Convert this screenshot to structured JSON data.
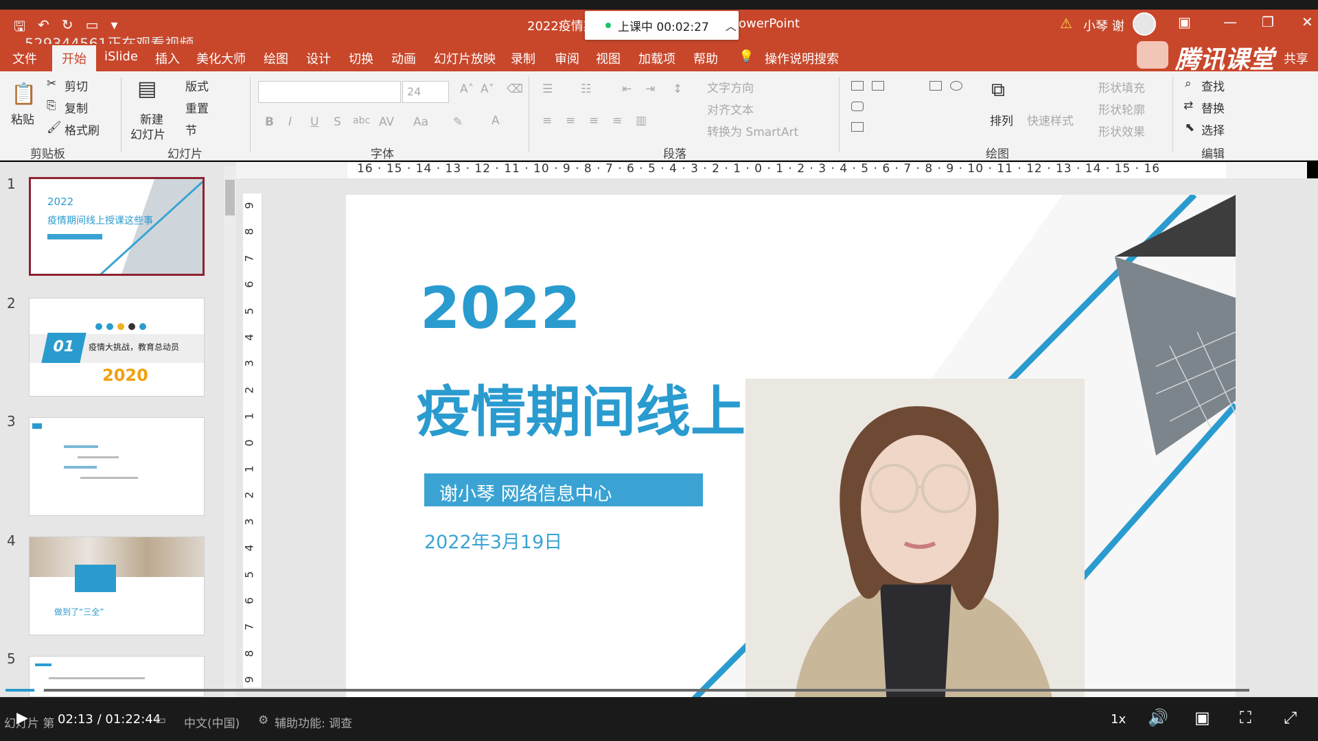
{
  "window": {
    "title_left": "2022疫情期",
    "title_right": "owerPoint",
    "viewer_notice": "529344561正在观看视频",
    "user_name": "小琴 谢"
  },
  "live_status": {
    "label": "上课中 00:02:27"
  },
  "brand": {
    "name": "腾讯课堂",
    "share": "共享"
  },
  "tabs": [
    "文件",
    "开始",
    "iSlide",
    "插入",
    "美化大师",
    "绘图",
    "设计",
    "切换",
    "动画",
    "幻灯片放映",
    "录制",
    "审阅",
    "视图",
    "加载项",
    "帮助",
    "操作说明搜索"
  ],
  "ribbon": {
    "clipboard": {
      "paste": "粘贴",
      "cut": "剪切",
      "copy": "复制",
      "format_painter": "格式刷",
      "label": "剪贴板"
    },
    "slides": {
      "new_slide_1": "新建",
      "new_slide_2": "幻灯片",
      "layout": "版式",
      "reset": "重置",
      "section": "节",
      "label": "幻灯片"
    },
    "font": {
      "size": "24",
      "label": "字体"
    },
    "paragraph": {
      "text_direction": "文字方向",
      "align_text": "对齐文本",
      "convert_smartart": "转换为 SmartArt",
      "label": "段落"
    },
    "drawing": {
      "arrange": "排列",
      "quick_styles": "快速样式",
      "shape_fill": "形状填充",
      "shape_outline": "形状轮廓",
      "shape_effects": "形状效果",
      "label": "绘图"
    },
    "editing": {
      "find": "查找",
      "replace": "替换",
      "select": "选择",
      "label": "编辑"
    }
  },
  "ruler": {
    "horizontal": "16 · 15 · 14 · 13 · 12 · 11 · 10 · 9 · 8 · 7 · 6 · 5 · 4 · 3 · 2 · 1 · 0 · 1 · 2 · 3 · 4 · 5 · 6 · 7 · 8 · 9 · 10 · 11 · 12 · 13 · 14 · 15 · 16",
    "vertical": [
      "9",
      "8",
      "7",
      "6",
      "5",
      "4",
      "3",
      "2",
      "1",
      "0",
      "1",
      "2",
      "3",
      "4",
      "5",
      "6",
      "7",
      "8",
      "9"
    ]
  },
  "thumbnails": [
    {
      "num": "1",
      "line1": "2022",
      "line2": "疫情期间线上授课这些事"
    },
    {
      "num": "2",
      "badge": "01",
      "caption": "疫情大挑战，教育总动员",
      "year": "2020"
    },
    {
      "num": "3"
    },
    {
      "num": "4",
      "caption": "做到了“三全”"
    },
    {
      "num": "5"
    }
  ],
  "slide": {
    "year": "2022",
    "title": "疫情期间线上授课这些事",
    "presenter": "谢小琴  网络信息中心",
    "date": "2022年3月19日"
  },
  "statusbar": {
    "slide_prefix": "幻灯片 第",
    "time": "02:13 / 01:22:44",
    "language": "中文(中国)",
    "accessibility": "辅助功能: 调查",
    "speed": "1x"
  },
  "colors": {
    "accent": "#c8472b",
    "slide_blue": "#2a9bcf",
    "selected_thumb": "#8d2232"
  }
}
